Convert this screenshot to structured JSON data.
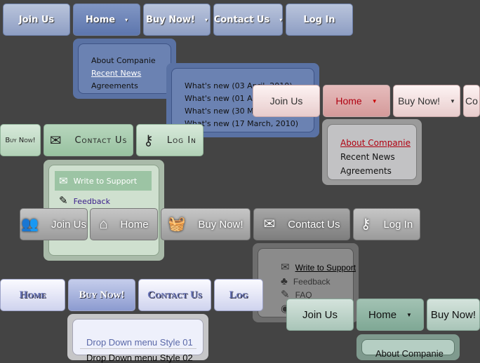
{
  "menus": [
    {
      "id": "blue",
      "buttons": [
        {
          "label": "Join Us"
        },
        {
          "label": "Home",
          "active": true,
          "arrow": "▾"
        },
        {
          "label": "Buy Now!",
          "arrow": "▾"
        },
        {
          "label": "Contact Us",
          "arrow": "▾"
        },
        {
          "label": "Log In"
        }
      ],
      "dropdowns": [
        {
          "items": [
            {
              "label": "About Companie"
            },
            {
              "label": "Recent News",
              "hover": true,
              "arrow": "▸"
            },
            {
              "label": "Agreements"
            }
          ]
        },
        {
          "items": [
            {
              "label": "What's new (03 April, 2010)"
            },
            {
              "label": "What's new (01 April, 2010)"
            },
            {
              "label": "What's new (30 March, 2010)"
            },
            {
              "label": "What's new (17 March, 2010)"
            }
          ]
        }
      ]
    },
    {
      "id": "green",
      "buttons": [
        {
          "label": "Buy Now!"
        },
        {
          "label": "Contact Us",
          "active": true,
          "icon": "envelope-icon",
          "glyph": "✉"
        },
        {
          "label": "Log In",
          "icon": "key-icon",
          "glyph": "⚷"
        }
      ],
      "dropdowns": [
        {
          "items": [
            {
              "label": "Write to Support",
              "hover": true,
              "icon": "envelope-icon",
              "glyph": "✉"
            },
            {
              "label": "Feedback",
              "icon": "pencil-icon",
              "glyph": "✎"
            }
          ]
        }
      ]
    },
    {
      "id": "pink",
      "buttons": [
        {
          "label": "Join Us"
        },
        {
          "label": "Home",
          "active": true,
          "arrow": "▼"
        },
        {
          "label": "Buy Now!",
          "arrow": "▼"
        },
        {
          "label": "Co"
        }
      ],
      "dropdowns": [
        {
          "items": [
            {
              "label": "About Companie",
              "hover": true
            },
            {
              "label": "Recent News"
            },
            {
              "label": "Agreements"
            }
          ]
        }
      ]
    },
    {
      "id": "gray",
      "buttons": [
        {
          "label": "Join Us",
          "icon": "users-icon",
          "glyph": "👥"
        },
        {
          "label": "Home",
          "icon": "house-icon",
          "glyph": "⌂"
        },
        {
          "label": "Buy Now!",
          "icon": "basket-icon",
          "glyph": "🧺"
        },
        {
          "label": "Contact Us",
          "active": true,
          "icon": "envelope-open-icon",
          "glyph": "✉"
        },
        {
          "label": "Log In",
          "icon": "key-icon",
          "glyph": "⚷"
        }
      ],
      "dropdowns": [
        {
          "items": [
            {
              "label": "Write to Support",
              "hover": true,
              "icon": "envelope-icon",
              "glyph": "✉"
            },
            {
              "label": "Feedback",
              "icon": "users-icon",
              "glyph": "♣"
            },
            {
              "label": "FAQ",
              "icon": "note-icon",
              "glyph": "✎"
            },
            {
              "label": "W",
              "icon": "globe-icon",
              "glyph": "◉"
            }
          ]
        }
      ]
    },
    {
      "id": "lav",
      "buttons": [
        {
          "label": "Home"
        },
        {
          "label": "Buy Now!",
          "active": true
        },
        {
          "label": "Contact Us"
        },
        {
          "label": "Log"
        }
      ],
      "dropdowns": [
        {
          "items": [
            {
              "label": "Drop Down menu Style 01",
              "hover": true
            },
            {
              "label": "Drop Down menu Style 02"
            }
          ]
        }
      ]
    },
    {
      "id": "teal",
      "buttons": [
        {
          "label": "Join Us"
        },
        {
          "label": "Home",
          "active": true,
          "arrow": "▼"
        },
        {
          "label": "Buy Now!"
        }
      ],
      "dropdowns": [
        {
          "items": [
            {
              "label": "About Companie"
            }
          ]
        }
      ]
    }
  ],
  "colors": {
    "background": "#444444",
    "pink_hover": "#b00010",
    "green_hover_bg": "#9cc4a4",
    "lav_hover": "#5a68a8",
    "green_link": "#3a1c8c"
  }
}
